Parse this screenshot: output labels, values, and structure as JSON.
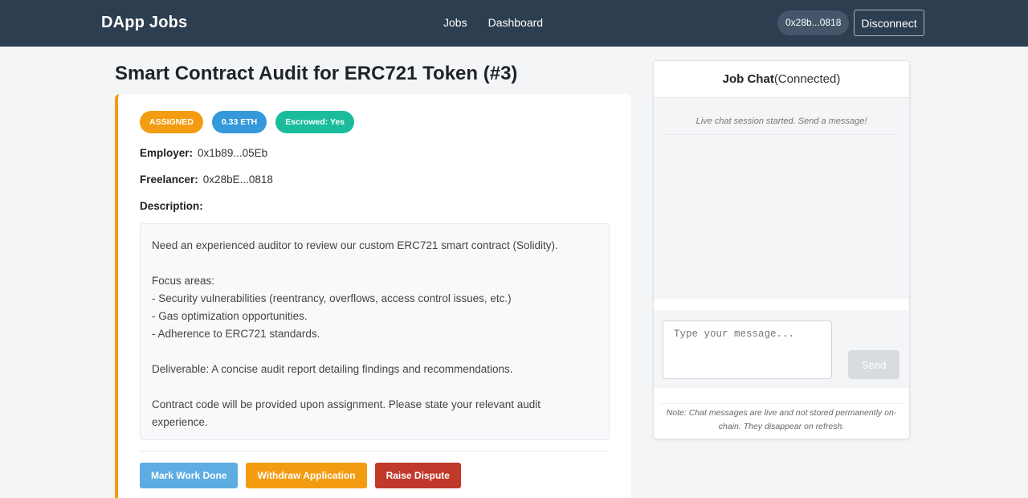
{
  "navbar": {
    "brand": "DApp Jobs",
    "links": [
      "Jobs",
      "Dashboard"
    ],
    "wallet_address": "0x28b...0818",
    "disconnect_label": "Disconnect",
    "background_color": "#2c3e50"
  },
  "job": {
    "title": "Smart Contract Audit for ERC721 Token (#3)",
    "badges": {
      "status": "ASSIGNED",
      "amount": "0.33 ETH",
      "escrow": "Escrowed: Yes"
    },
    "employer_label": "Employer:",
    "employer": "0x1b89...05Eb",
    "freelancer_label": "Freelancer:",
    "freelancer": "0x28bE...0818",
    "description_label": "Description:",
    "description": {
      "intro": "Need an experienced auditor to review our custom ERC721 smart contract (Solidity).",
      "focus_title": "Focus areas:",
      "focus_items": [
        "- Security vulnerabilities (reentrancy, overflows, access control issues, etc.)",
        "- Gas optimization opportunities.",
        "- Adherence to ERC721 standards."
      ],
      "deliverable": "Deliverable: A concise audit report detailing findings and recommendations.",
      "closing": "Contract code will be provided upon assignment. Please state your relevant audit experience."
    },
    "actions": {
      "mark_done": "Mark Work Done",
      "withdraw": "Withdraw Application",
      "dispute": "Raise Dispute"
    },
    "colors": {
      "accent": "#f39c12",
      "blue": "#3498db",
      "teal": "#1abc9c",
      "red": "#c0392b"
    }
  },
  "chat": {
    "title": "Job Chat",
    "status": "(Connected)",
    "system_message": "Live chat session started. Send a message!",
    "input_placeholder": "Type your message...",
    "send_label": "Send",
    "note": "Note: Chat messages are live and not stored permanently on-chain. They disappear on refresh."
  }
}
